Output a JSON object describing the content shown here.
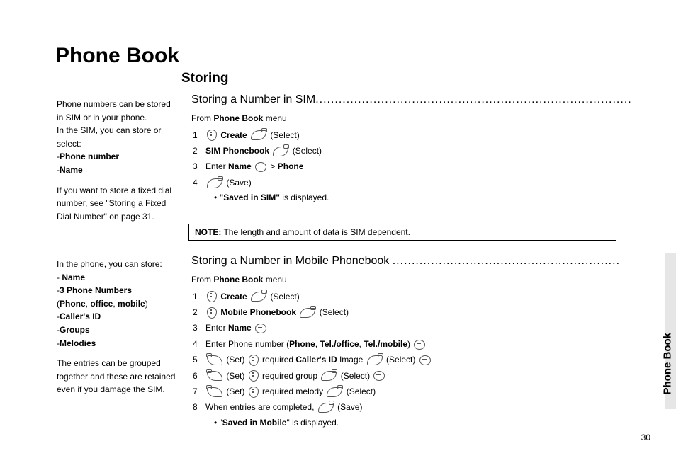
{
  "title": "Phone Book",
  "section": "Storing",
  "page_number": "30",
  "side_tab": "Phone Book",
  "sub1": {
    "heading": "Storing a Number in SIM",
    "dots": "..................................................................................",
    "from_menu_prefix": "From ",
    "from_menu_bold": "Phone Book",
    "from_menu_suffix": " menu",
    "step1_b": "Create",
    "step1_paren": "(Select)",
    "step2_b": "SIM Phonebook",
    "step2_paren": "(Select)",
    "step3_a": "Enter ",
    "step3_b1": "Name",
    "step3_mid": "  > ",
    "step3_b2": "Phone",
    "step4_paren": "(Save)",
    "result_prefix": "• ",
    "result_bold": "\"Saved in SIM\"",
    "result_suffix": " is displayed."
  },
  "note": {
    "label": "NOTE:",
    "text": " The length and amount of data is SIM dependent."
  },
  "sub2": {
    "heading": "Storing a Number in Mobile Phonebook",
    "dots": "...........................................................",
    "from_menu_prefix": "From ",
    "from_menu_bold": "Phone Book",
    "from_menu_suffix": " menu",
    "step1_b": "Create",
    "step1_paren": "(Select)",
    "step2_b": "Mobile Phonebook",
    "step2_paren": "(Select)",
    "step3_a": "Enter ",
    "step3_b": "Name",
    "step4_a": "Enter Phone number (",
    "step4_b1": "Phone",
    "step4_c": ", ",
    "step4_b2": "Tel./office",
    "step4_b3": "Tel./mobile",
    "step4_d": ")",
    "step5_set": "(Set)",
    "step5_mid": "required ",
    "step5_b": "Caller's ID",
    "step5_img": " Image",
    "step5_sel": "(Select)",
    "step6_set": "(Set)",
    "step6_mid": "required group",
    "step6_sel": "(Select)",
    "step7_set": "(Set)",
    "step7_mid": "required melody",
    "step7_sel": "(Select)",
    "step8_a": "When entries are completed,",
    "step8_paren": "(Save)",
    "result_prefix": "• \"",
    "result_bold": "Saved in Mobile",
    "result_suffix": "\" is displayed."
  },
  "sidebar1": {
    "p1": "Phone numbers can be stored in SIM or in your phone.",
    "p2": "In the SIM, you can store or select:",
    "li1": "Phone number",
    "li2": "Name",
    "p3": "If you want to store a fixed dial number, see \"Storing a Fixed Dial Number\" on page 31."
  },
  "sidebar2": {
    "p1": "In the phone, you can store:",
    "li1": "Name",
    "li2a": "3 Phone Numbers",
    "li2b_open": " (",
    "li2b_1": "Phone",
    "li2b_c": ", ",
    "li2b_2": "office",
    "li2b_3": "mobile",
    "li2b_close": ")",
    "li3": "Caller's ID",
    "li4": "Groups",
    "li5": "Melodies",
    "p2": "The entries can be grouped together and these are retained even if you damage the SIM."
  }
}
